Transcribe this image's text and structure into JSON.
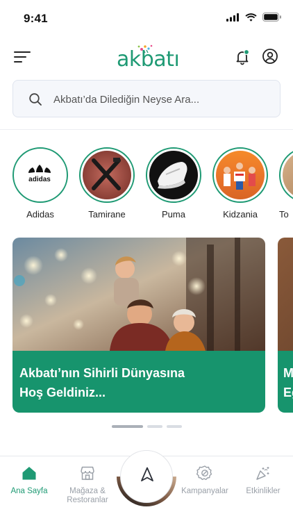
{
  "status_bar": {
    "time": "9:41"
  },
  "header": {
    "logo_text": "akbatı"
  },
  "search": {
    "placeholder": "Akbatı’da Dilediğin Neyse Ara..."
  },
  "stories": [
    {
      "label": "Adidas"
    },
    {
      "label": "Tamirane"
    },
    {
      "label": "Puma"
    },
    {
      "label": "Kidzania"
    },
    {
      "label": "To"
    }
  ],
  "banners": [
    {
      "title_line1": "Akbatı’nın Sihirli Dünyasına",
      "title_line2": "Hoş Geldiniz..."
    },
    {
      "title_line1": "M",
      "title_line2": "Eğ"
    }
  ],
  "pager": {
    "count": 3,
    "active_index": 0
  },
  "tab_bar": {
    "tabs": [
      {
        "label": "Ana Sayfa",
        "icon": "home-icon",
        "active": true
      },
      {
        "label": "Mağaza & Restoranlar",
        "icon": "store-icon",
        "active": false
      },
      {
        "label": "Kampanyalar",
        "icon": "badge-percent-icon",
        "active": false
      },
      {
        "label": "Etkinlikler",
        "icon": "party-icon",
        "active": false
      }
    ],
    "center_icon": "navigation-arrow-icon"
  },
  "colors": {
    "brand": "#1f9a74",
    "banner_caption": "#17946d",
    "inactive_tab": "#9aa0a8"
  }
}
